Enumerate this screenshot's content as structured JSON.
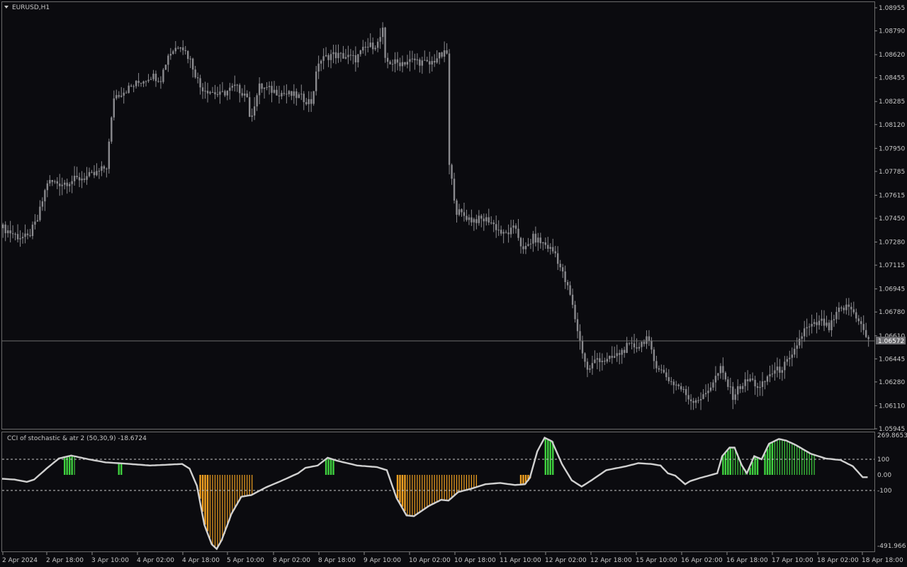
{
  "symbol_title": "EURUSD,H1",
  "indicator_title": "CCI of stochastic & atr 2 (50,30,9) -18.6724",
  "current_price": "1.06572",
  "price_axis": [
    {
      "label": "1.08955",
      "value": 1.08955
    },
    {
      "label": "1.08790",
      "value": 1.0879
    },
    {
      "label": "1.08620",
      "value": 1.0862
    },
    {
      "label": "1.08455",
      "value": 1.08455
    },
    {
      "label": "1.08285",
      "value": 1.08285
    },
    {
      "label": "1.08120",
      "value": 1.0812
    },
    {
      "label": "1.07950",
      "value": 1.0795
    },
    {
      "label": "1.07785",
      "value": 1.07785
    },
    {
      "label": "1.07615",
      "value": 1.07615
    },
    {
      "label": "1.07450",
      "value": 1.0745
    },
    {
      "label": "1.07280",
      "value": 1.0728
    },
    {
      "label": "1.07115",
      "value": 1.07115
    },
    {
      "label": "1.06945",
      "value": 1.06945
    },
    {
      "label": "1.06780",
      "value": 1.0678
    },
    {
      "label": "1.06610",
      "value": 1.0661
    },
    {
      "label": "1.06445",
      "value": 1.06445
    },
    {
      "label": "1.06280",
      "value": 1.0628
    },
    {
      "label": "1.06110",
      "value": 1.0611
    },
    {
      "label": "1.05945",
      "value": 1.05945
    }
  ],
  "indicator_axis": [
    {
      "label": "269.8653",
      "value": 269.8653
    },
    {
      "label": "100",
      "value": 100
    },
    {
      "label": "0.00",
      "value": 0
    },
    {
      "label": "-100",
      "value": -100
    },
    {
      "label": "-491.966",
      "value": -491.966
    }
  ],
  "time_axis": [
    "2 Apr 2024",
    "2 Apr 18:00",
    "3 Apr 10:00",
    "4 Apr 02:00",
    "4 Apr 18:00",
    "5 Apr 10:00",
    "8 Apr 02:00",
    "8 Apr 18:00",
    "9 Apr 10:00",
    "10 Apr 02:00",
    "10 Apr 18:00",
    "11 Apr 10:00",
    "12 Apr 02:00",
    "12 Apr 18:00",
    "15 Apr 10:00",
    "16 Apr 02:00",
    "16 Apr 18:00",
    "17 Apr 10:00",
    "18 Apr 02:00",
    "18 Apr 18:00"
  ],
  "colors": {
    "background": "#0b0b0f",
    "grid_frame": "#6a6a6a",
    "candle": "#8a8a8e",
    "line": "#d0d0d0",
    "bull_hist": "#3fd13f",
    "bear_hist": "#f0a020",
    "text": "#c8c8c8"
  },
  "chart_data": [
    {
      "type": "candlestick",
      "title": "EURUSD,H1",
      "ylim": [
        1.0594,
        1.0903
      ],
      "close_path": [
        [
          0,
          1.0738
        ],
        [
          6,
          1.0732
        ],
        [
          10,
          1.0731
        ],
        [
          14,
          1.0744
        ],
        [
          18,
          1.0771
        ],
        [
          24,
          1.077
        ],
        [
          30,
          1.0773
        ],
        [
          37,
          1.0776
        ],
        [
          42,
          1.0782
        ],
        [
          45,
          1.0832
        ],
        [
          52,
          1.0839
        ],
        [
          60,
          1.0847
        ],
        [
          64,
          1.0845
        ],
        [
          67,
          1.0862
        ],
        [
          72,
          1.087
        ],
        [
          76,
          1.0858
        ],
        [
          80,
          1.0839
        ],
        [
          88,
          1.0833
        ],
        [
          94,
          1.0839
        ],
        [
          99,
          1.0833
        ],
        [
          100,
          1.0815
        ],
        [
          104,
          1.0839
        ],
        [
          112,
          1.0835
        ],
        [
          120,
          1.0832
        ],
        [
          125,
          1.0828
        ],
        [
          128,
          1.0857
        ],
        [
          133,
          1.0862
        ],
        [
          138,
          1.0861
        ],
        [
          143,
          1.0859
        ],
        [
          147,
          1.0867
        ],
        [
          152,
          1.087
        ],
        [
          154,
          1.0879
        ],
        [
          155,
          1.0857
        ],
        [
          160,
          1.0856
        ],
        [
          167,
          1.0858
        ],
        [
          173,
          1.0855
        ],
        [
          176,
          1.086
        ],
        [
          180,
          1.0863
        ],
        [
          181,
          1.0782
        ],
        [
          184,
          1.075
        ],
        [
          190,
          1.0744
        ],
        [
          197,
          1.0744
        ],
        [
          203,
          1.0733
        ],
        [
          208,
          1.0738
        ],
        [
          211,
          1.0721
        ],
        [
          215,
          1.0731
        ],
        [
          220,
          1.0726
        ],
        [
          224,
          1.072
        ],
        [
          230,
          1.069
        ],
        [
          234,
          1.0657
        ],
        [
          237,
          1.0636
        ],
        [
          241,
          1.0645
        ],
        [
          245,
          1.0643
        ],
        [
          249,
          1.0647
        ],
        [
          253,
          1.0653
        ],
        [
          258,
          1.0654
        ],
        [
          261,
          1.066
        ],
        [
          264,
          1.0643
        ],
        [
          267,
          1.0636
        ],
        [
          271,
          1.0628
        ],
        [
          274,
          1.0625
        ],
        [
          279,
          1.0615
        ],
        [
          284,
          1.0617
        ],
        [
          291,
          1.0637
        ],
        [
          296,
          1.0618
        ],
        [
          299,
          1.0625
        ],
        [
          303,
          1.063
        ],
        [
          307,
          1.0623
        ],
        [
          311,
          1.0634
        ],
        [
          315,
          1.0637
        ],
        [
          320,
          1.0645
        ],
        [
          322,
          1.0655
        ],
        [
          325,
          1.0665
        ],
        [
          332,
          1.0671
        ],
        [
          335,
          1.0666
        ],
        [
          339,
          1.0679
        ],
        [
          343,
          1.0682
        ],
        [
          347,
          1.0673
        ],
        [
          349,
          1.0664
        ],
        [
          351,
          1.0657
        ]
      ]
    },
    {
      "type": "line",
      "title": "CCI of stochastic & atr 2 (50,30,9) -18.6724",
      "ylim": [
        -491.966,
        269.8653
      ],
      "levels": [
        100,
        -100
      ],
      "line_path": [
        [
          0,
          -25
        ],
        [
          5,
          -30
        ],
        [
          10,
          -45
        ],
        [
          13,
          -30
        ],
        [
          18,
          40
        ],
        [
          23,
          105
        ],
        [
          28,
          124
        ],
        [
          35,
          100
        ],
        [
          42,
          80
        ],
        [
          50,
          72
        ],
        [
          60,
          60
        ],
        [
          67,
          65
        ],
        [
          73,
          70
        ],
        [
          76,
          40
        ],
        [
          79,
          -70
        ],
        [
          82,
          -320
        ],
        [
          85,
          -445
        ],
        [
          87,
          -475
        ],
        [
          89,
          -420
        ],
        [
          93,
          -250
        ],
        [
          97,
          -140
        ],
        [
          101,
          -130
        ],
        [
          107,
          -80
        ],
        [
          113,
          -40
        ],
        [
          120,
          10
        ],
        [
          123,
          45
        ],
        [
          128,
          60
        ],
        [
          132,
          110
        ],
        [
          136,
          90
        ],
        [
          144,
          60
        ],
        [
          152,
          50
        ],
        [
          156,
          30
        ],
        [
          160,
          -150
        ],
        [
          164,
          -260
        ],
        [
          167,
          -265
        ],
        [
          173,
          -200
        ],
        [
          178,
          -160
        ],
        [
          181,
          -165
        ],
        [
          185,
          -110
        ],
        [
          190,
          -90
        ],
        [
          196,
          -60
        ],
        [
          202,
          -52
        ],
        [
          208,
          -65
        ],
        [
          212,
          -60
        ],
        [
          214,
          -20
        ],
        [
          217,
          150
        ],
        [
          220,
          238
        ],
        [
          223,
          215
        ],
        [
          227,
          70
        ],
        [
          231,
          -35
        ],
        [
          235,
          -75
        ],
        [
          239,
          -35
        ],
        [
          245,
          30
        ],
        [
          253,
          55
        ],
        [
          258,
          75
        ],
        [
          263,
          70
        ],
        [
          267,
          60
        ],
        [
          270,
          10
        ],
        [
          273,
          -5
        ],
        [
          277,
          -60
        ],
        [
          279,
          -40
        ],
        [
          283,
          -20
        ],
        [
          290,
          10
        ],
        [
          292,
          120
        ],
        [
          295,
          175
        ],
        [
          297,
          175
        ],
        [
          300,
          60
        ],
        [
          302,
          10
        ],
        [
          305,
          120
        ],
        [
          308,
          100
        ],
        [
          311,
          200
        ],
        [
          315,
          230
        ],
        [
          318,
          220
        ],
        [
          322,
          190
        ],
        [
          328,
          135
        ],
        [
          334,
          105
        ],
        [
          340,
          95
        ],
        [
          345,
          55
        ],
        [
          349,
          -15
        ]
      ],
      "green_zones": [
        [
          25,
          29
        ],
        [
          47,
          48
        ],
        [
          131,
          134
        ],
        [
          220,
          223
        ],
        [
          292,
          301
        ],
        [
          303,
          306
        ],
        [
          309,
          329
        ]
      ],
      "orange_zones": [
        [
          80,
          101
        ],
        [
          160,
          192
        ],
        [
          210,
          214
        ]
      ]
    }
  ]
}
